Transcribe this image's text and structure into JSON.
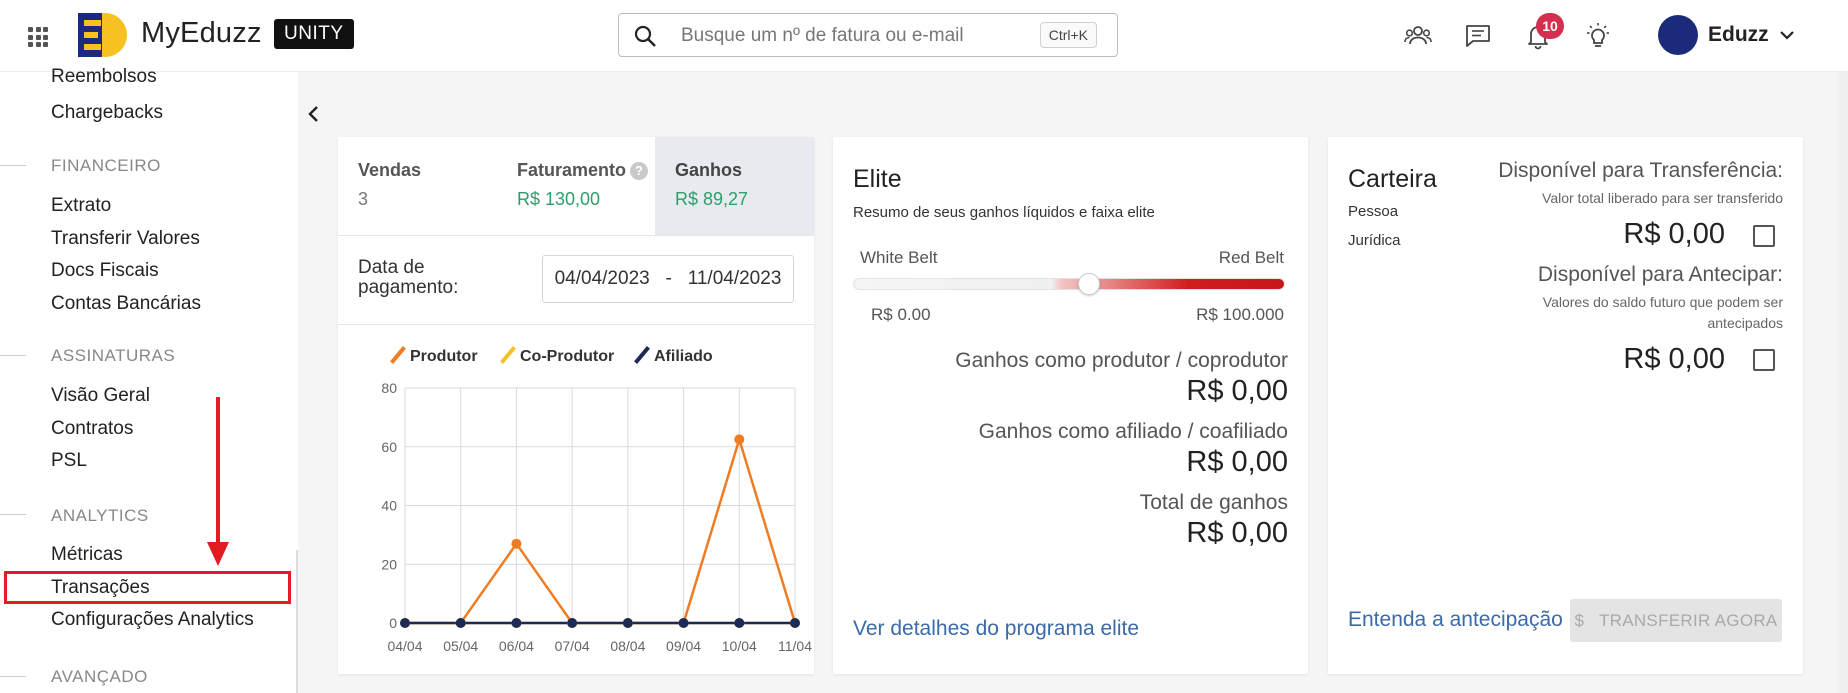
{
  "header": {
    "brand": "MyEduzz",
    "badge": "UNITY",
    "search_placeholder": "Busque um nº de fatura ou e-mail",
    "search_shortcut": "Ctrl+K",
    "notification_count": "10",
    "user_name": "Eduzz",
    "icons": [
      "apps-grid-icon",
      "people-icon",
      "chat-icon",
      "bell-icon",
      "lightbulb-icon",
      "chevron-down-icon"
    ]
  },
  "sidebar": {
    "items_top": [
      "Reembolsos",
      "Chargebacks"
    ],
    "sections": [
      {
        "title": "FINANCEIRO",
        "items": [
          "Extrato",
          "Transferir Valores",
          "Docs Fiscais",
          "Contas Bancárias"
        ]
      },
      {
        "title": "ASSINATURAS",
        "items": [
          "Visão Geral",
          "Contratos",
          "PSL"
        ]
      },
      {
        "title": "ANALYTICS",
        "items": [
          "Métricas",
          "Transações",
          "Configurações Analytics"
        ]
      },
      {
        "title": "AVANÇADO",
        "items": []
      }
    ],
    "highlighted_item": "Transações",
    "highlight_color": "#e31b23"
  },
  "sales_card": {
    "stats": [
      {
        "label": "Vendas",
        "value": "3"
      },
      {
        "label": "Faturamento",
        "value": "R$ 130,00",
        "help": "?"
      },
      {
        "label": "Ganhos",
        "value": "R$ 89,27"
      }
    ],
    "date_label": "Data de pagamento:",
    "date_range": "04/04/2023   -   11/04/2023",
    "value_color": "#2e9e6a"
  },
  "chart_data": {
    "type": "line",
    "categories": [
      "04/04",
      "05/04",
      "06/04",
      "07/04",
      "08/04",
      "09/04",
      "10/04",
      "11/04"
    ],
    "series": [
      {
        "name": "Produtor",
        "color": "#f07c22",
        "values": [
          0,
          0,
          27,
          0,
          0,
          0,
          62.5,
          0
        ]
      },
      {
        "name": "Co-Produtor",
        "color": "#f3c22b",
        "values": [
          0,
          0,
          0,
          0,
          0,
          0,
          0,
          0
        ]
      },
      {
        "name": "Afiliado",
        "color": "#1e2a55",
        "values": [
          0,
          0,
          0,
          0,
          0,
          0,
          0,
          0
        ]
      }
    ],
    "y_ticks": [
      0,
      20,
      40,
      60,
      80
    ],
    "ylim": [
      0,
      80
    ],
    "grid": true,
    "legend_position": "top"
  },
  "elite_card": {
    "title": "Elite",
    "subtitle": "Resumo de seus ganhos líquidos e faixa elite",
    "belt_min_label": "White Belt",
    "belt_max_label": "Red Belt",
    "belt_min_value": "R$ 0.00",
    "belt_max_value": "R$ 100.000",
    "rows": [
      {
        "label": "Ganhos como produtor / coprodutor",
        "value": "R$ 0,00"
      },
      {
        "label": "Ganhos como afiliado / coafiliado",
        "value": "R$ 0,00"
      },
      {
        "label": "Total de ganhos",
        "value": "R$ 0,00"
      }
    ],
    "link": "Ver detalhes do programa elite"
  },
  "wallet_card": {
    "title": "Carteira",
    "types": [
      "Pessoa",
      "Jurídica"
    ],
    "available_title": "Disponível para Transferência:",
    "available_sub": "Valor total liberado para ser transferido",
    "available_amount": "R$ 0,00",
    "advance_title": "Disponível para Antecipar:",
    "advance_sub_1": "Valores do saldo futuro que podem ser",
    "advance_sub_2": "antecipados",
    "advance_amount": "R$ 0,00",
    "link": "Entenda a antecipação",
    "button": "$   TRANSFERIR AGORA"
  }
}
